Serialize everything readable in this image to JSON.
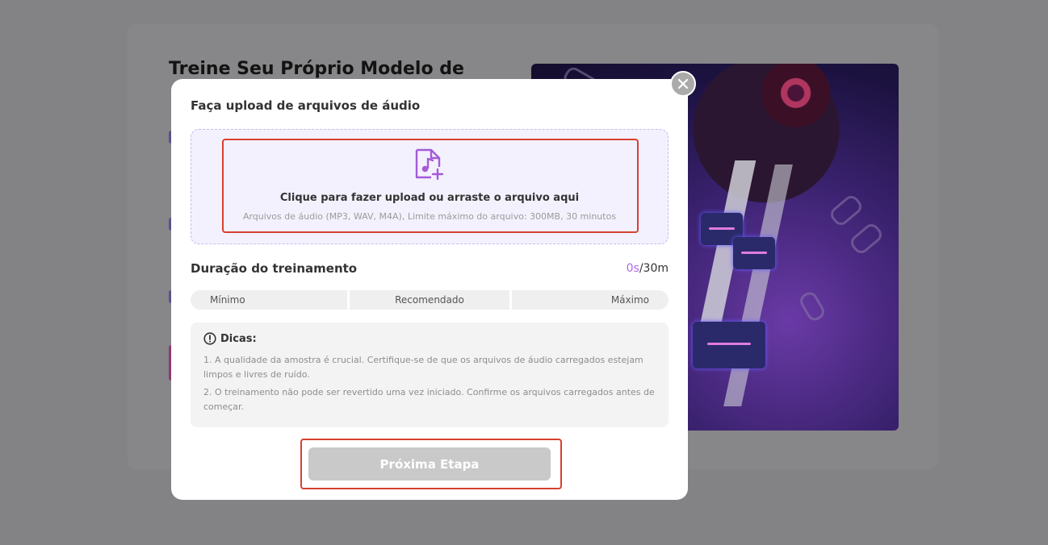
{
  "background": {
    "title": "Treine Seu Próprio Modelo de"
  },
  "modal": {
    "title": "Faça upload de arquivos de áudio",
    "upload": {
      "main_text": "Clique para fazer upload ou arraste o arquivo aqui",
      "sub_text": "Arquivos de áudio (MP3, WAV, M4A), Limite máximo do arquivo: 300MB, 30 minutos",
      "icon": "music-file-add-icon"
    },
    "duration": {
      "label": "Duração do treinamento",
      "current": "0s",
      "separator": "/",
      "max": "30m",
      "current_color": "#b066e8",
      "segments": [
        "Mínimo",
        "Recomendado",
        "Máximo"
      ]
    },
    "tips": {
      "title": "Dicas:",
      "icon": "info-icon",
      "items": [
        "1. A qualidade da amostra é crucial. Certifique-se de que os arquivos de áudio carregados estejam limpos e livres de ruído.",
        "2. O treinamento não pode ser revertido uma vez iniciado. Confirme os arquivos carregados antes de começar."
      ]
    },
    "next_button": "Próxima Etapa",
    "close_icon": "close-icon"
  },
  "colors": {
    "accent": "#b066e8",
    "highlight": "#d6402f",
    "button_disabled": "#c9c9c9",
    "dropzone_bg": "#f4f1ff"
  }
}
